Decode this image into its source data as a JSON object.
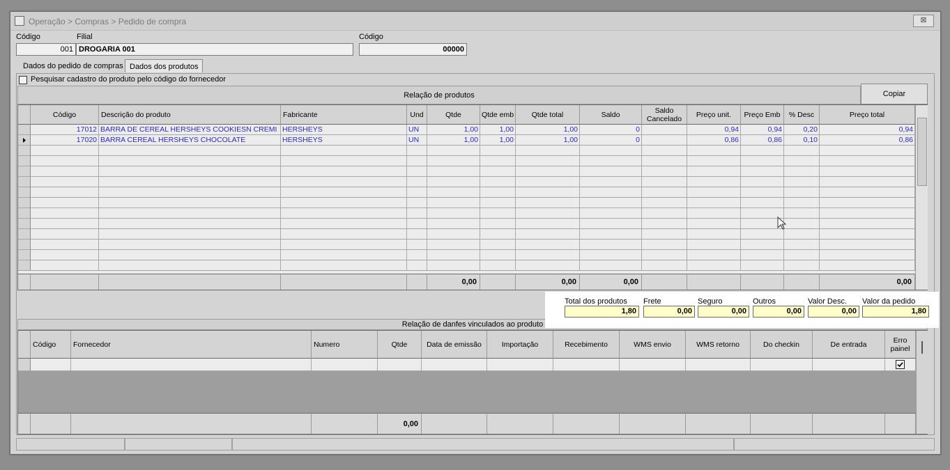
{
  "window": {
    "title": "Operação > Compras > Pedido de compra",
    "close_label": "⊠"
  },
  "header": {
    "codigo_label": "Código",
    "codigo_value": "001",
    "filial_label": "Filial",
    "filial_value": "DROGARIA 001",
    "codigo2_label": "Código",
    "codigo2_value": "00000"
  },
  "tabs": [
    {
      "label": "Dados do pedido de compras"
    },
    {
      "label": "Dados dos produtos"
    }
  ],
  "checkbox": {
    "label": "Pesquisar cadastro do produto pelo código do fornecedor",
    "checked": false
  },
  "produtos": {
    "section_label": "Relação de produtos",
    "copiar_label": "Copiar",
    "columns": [
      "Código",
      "Descrição do produto",
      "Fabricante",
      "Und",
      "Qtde",
      "Qtde emb",
      "Qtde total",
      "Saldo",
      "Saldo Cancelado",
      "Preço unit.",
      "Preço Emb",
      "% Desc",
      "Preço total"
    ],
    "rows": [
      {
        "codigo": "17012",
        "descricao": "BARRA DE CEREAL HERSHEYS COOKIESN CREMI",
        "fabricante": "HERSHEYS",
        "und": "UN",
        "qtde": "1,00",
        "qtde_emb": "1,00",
        "qtde_total": "1,00",
        "saldo": "0",
        "saldo_cancelado": "",
        "preco_unit": "0,94",
        "preco_emb": "0,94",
        "desc": "0,20",
        "preco_total": "0,94"
      },
      {
        "codigo": "17020",
        "descricao": "BARRA CEREAL HERSHEYS CHOCOLATE",
        "fabricante": "HERSHEYS",
        "und": "UN",
        "qtde": "1,00",
        "qtde_emb": "1,00",
        "qtde_total": "1,00",
        "saldo": "0",
        "saldo_cancelado": "",
        "preco_unit": "0,86",
        "preco_emb": "0,86",
        "desc": "0,10",
        "preco_total": "0,86"
      }
    ],
    "footer": {
      "qtde": "0,00",
      "qtde_total": "0,00",
      "saldo": "0,00",
      "preco_total": "0,00"
    }
  },
  "totals": {
    "total_produtos_label": "Total dos produtos",
    "total_produtos": "1,80",
    "frete_label": "Frete",
    "frete": "0,00",
    "seguro_label": "Seguro",
    "seguro": "0,00",
    "outros_label": "Outros",
    "outros": "0,00",
    "valor_desc_label": "Valor Desc.",
    "valor_desc": "0,00",
    "valor_pedido_label": "Valor da pedido",
    "valor_pedido": "1,80"
  },
  "danfes": {
    "section_label": "Relação de danfes vinculados ao produto",
    "columns": [
      "Código",
      "Fornecedor",
      "Numero",
      "Qtde",
      "Data de emissão",
      "Importação",
      "Recebimento",
      "WMS envio",
      "WMS retorno",
      "Do checkin",
      "De entrada",
      "Erro painel"
    ],
    "footer_qtde": "0,00",
    "erro_painel_checked": true
  }
}
